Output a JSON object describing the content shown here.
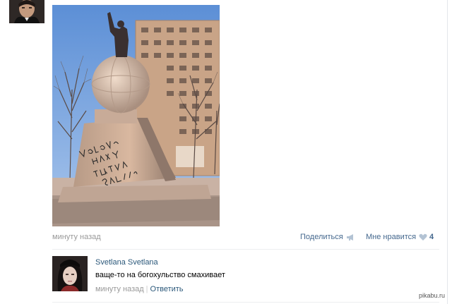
{
  "post": {
    "time": "минуту назад",
    "share_label": "Поделиться",
    "like_label": "Мне нравится",
    "like_count": "4",
    "image": {
      "graffiti_text": "Володя, нах уя ты туда залез?"
    }
  },
  "comment": {
    "author": "Svetlana Svetlana",
    "text": "ваще-то на богохульство смахивает",
    "time": "минуту назад",
    "separator": "|",
    "reply_label": "Ответить"
  },
  "watermark": "pikabu.ru",
  "colors": {
    "link": "#45688e",
    "author": "#2b587a",
    "meta": "#999999",
    "divider": "#edeef0"
  },
  "icons": {
    "share": "megaphone-icon",
    "like": "heart-icon"
  }
}
